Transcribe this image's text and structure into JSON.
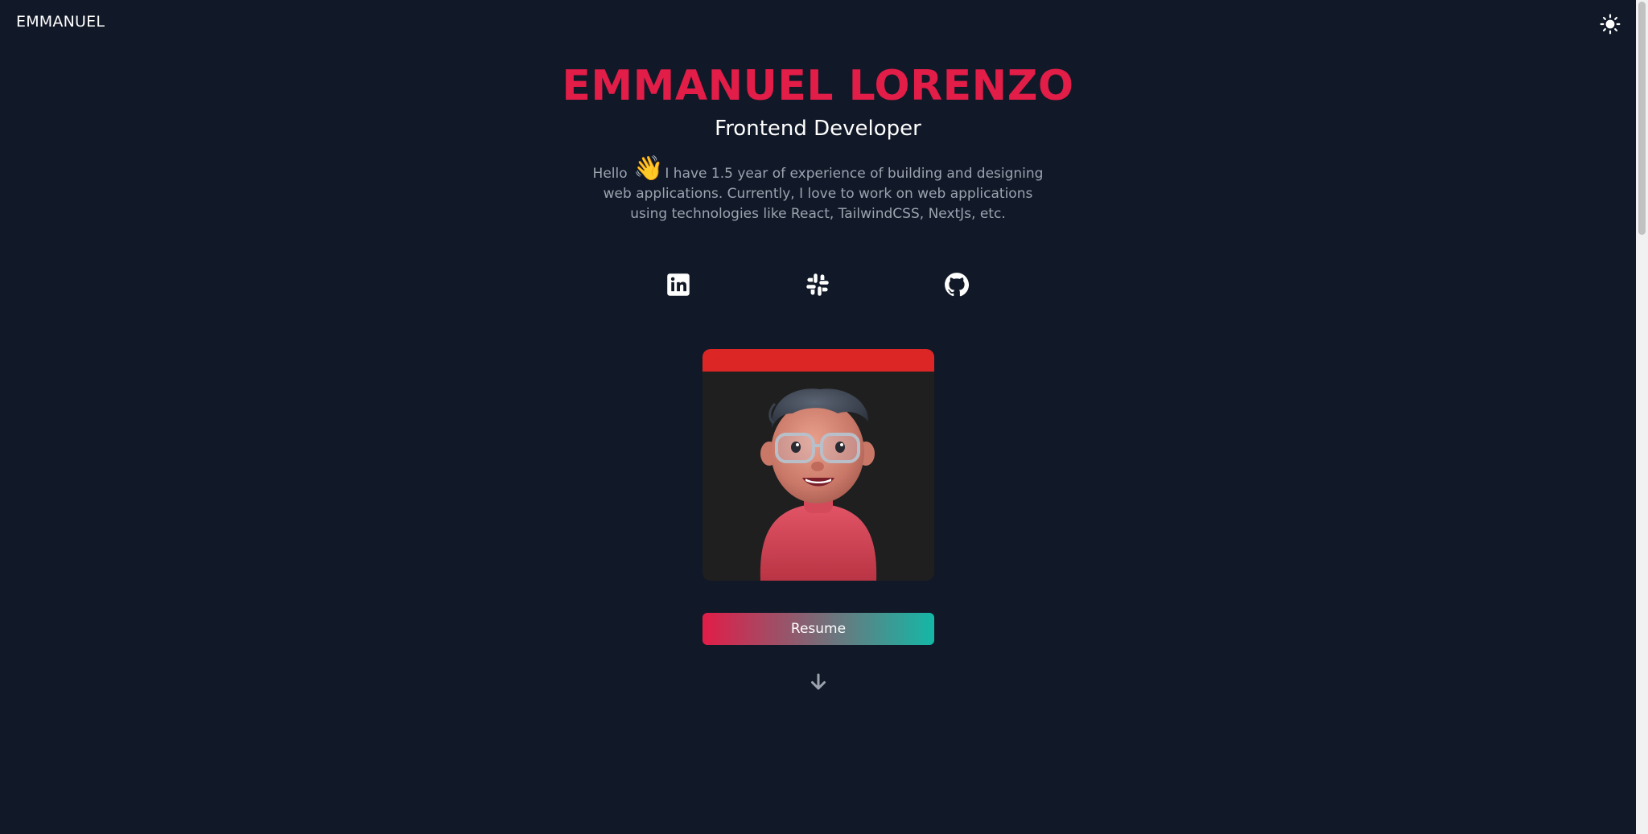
{
  "header": {
    "brand": "EMMANUEL",
    "theme_toggle_icon": "sun-icon"
  },
  "hero": {
    "name": "EMMANUEL LORENZO",
    "role": "Frontend Developer",
    "bio_prefix": "Hello",
    "bio_emoji": "👋",
    "bio_text": "I have 1.5 year of experience of building and designing web applications. Currently, I love to work on web applications using technologies like React, TailwindCSS, NextJs, etc."
  },
  "socials": [
    {
      "icon": "linkedin-icon"
    },
    {
      "icon": "slack-icon"
    },
    {
      "icon": "github-icon"
    }
  ],
  "resume_button": {
    "label": "Resume"
  },
  "scroll_hint": {
    "icon": "arrow-down-icon"
  },
  "colors": {
    "background": "#111827",
    "accent": "#e11d48",
    "gradient_end": "#14b8a6",
    "card_top": "#dc2626",
    "muted_text": "#9ca3af"
  }
}
